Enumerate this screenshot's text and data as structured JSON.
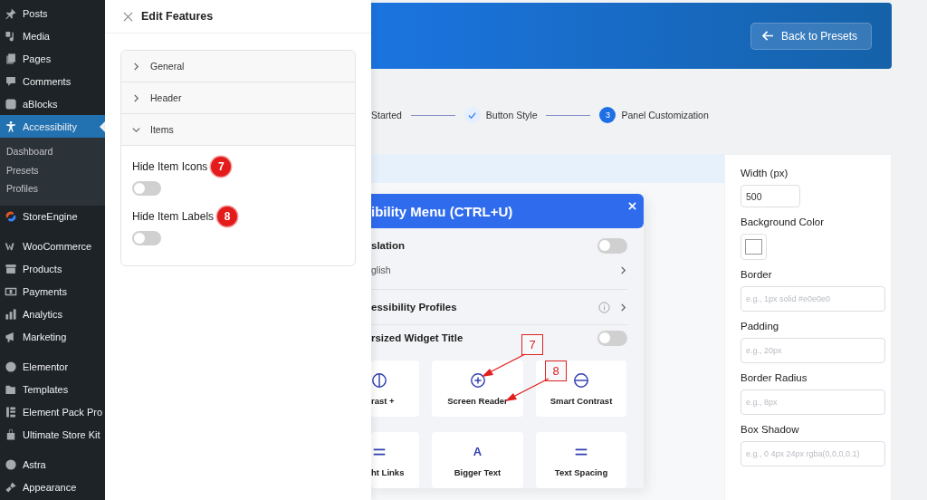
{
  "sidebar": {
    "groups": [
      {
        "items": [
          {
            "label": "Posts",
            "selected": false
          },
          {
            "label": "Media",
            "selected": false
          },
          {
            "label": "Pages",
            "selected": false
          },
          {
            "label": "Comments",
            "selected": false
          },
          {
            "label": "aBlocks",
            "selected": false
          },
          {
            "label": "Accessibility",
            "selected": true,
            "children": [
              {
                "label": "Dashboard",
                "selected": false
              },
              {
                "label": "Presets",
                "selected": false
              },
              {
                "label": "Profiles",
                "selected": false
              }
            ]
          },
          {
            "label": "StoreEngine",
            "selected": false
          }
        ]
      },
      {
        "items": [
          {
            "label": "WooCommerce",
            "selected": false
          },
          {
            "label": "Products",
            "selected": false
          },
          {
            "label": "Payments",
            "selected": false
          },
          {
            "label": "Analytics",
            "selected": false
          },
          {
            "label": "Marketing",
            "selected": false
          }
        ]
      },
      {
        "items": [
          {
            "label": "Elementor",
            "selected": false
          },
          {
            "label": "Templates",
            "selected": false
          },
          {
            "label": "Element Pack Pro",
            "selected": false
          },
          {
            "label": "Ultimate Store Kit",
            "selected": false
          }
        ]
      },
      {
        "items": [
          {
            "label": "Astra",
            "selected": false
          },
          {
            "label": "Appearance",
            "selected": false
          }
        ]
      }
    ]
  },
  "drawer": {
    "title": "Edit Features",
    "sections": [
      {
        "label": "General",
        "expanded": false
      },
      {
        "label": "Header",
        "expanded": false
      },
      {
        "label": "Items",
        "expanded": true,
        "settings": [
          {
            "label": "Hide Item Icons",
            "badge": "7",
            "on": false
          },
          {
            "label": "Hide Item Labels",
            "badge": "8",
            "on": false
          }
        ]
      }
    ]
  },
  "banner": {
    "button": "Back to Presets"
  },
  "steps": [
    {
      "label": "Started"
    },
    {
      "label": "Button Style",
      "completed": true
    },
    {
      "label": "Panel Customization",
      "completed": false,
      "number": "3"
    }
  ],
  "preview": {
    "title": "ibility Menu (CTRL+U)",
    "rows": [
      {
        "kind": "toggle",
        "label": "slation",
        "on": false
      },
      {
        "kind": "select",
        "label": "glish"
      },
      {
        "kind": "link",
        "label": "essibility Profiles"
      },
      {
        "kind": "toggle",
        "label": "rsized Widget Title",
        "on": false
      }
    ],
    "tiles": [
      {
        "label": "rast +",
        "kind": "contrast"
      },
      {
        "label": "Screen Reader",
        "kind": "plus"
      },
      {
        "label": "Smart Contrast",
        "kind": "minus"
      },
      {
        "label": "ht Links",
        "kind": "equals"
      },
      {
        "label": "Bigger Text",
        "kind": "letter",
        "glyph": "A"
      },
      {
        "label": "Text Spacing",
        "kind": "equals"
      }
    ],
    "annotations": [
      "7",
      "8"
    ]
  },
  "settings": [
    {
      "label": "Width (px)",
      "kind": "input",
      "value": "500"
    },
    {
      "label": "Background Color",
      "kind": "color"
    },
    {
      "label": "Border",
      "kind": "input",
      "placeholder": "e.g., 1px solid #e0e0e0"
    },
    {
      "label": "Padding",
      "kind": "input",
      "placeholder": "e.g., 20px"
    },
    {
      "label": "Border Radius",
      "kind": "input",
      "placeholder": "e.g., 8px"
    },
    {
      "label": "Box Shadow",
      "kind": "input",
      "placeholder": "e.g., 0 4px 24px rgba(0,0,0,0.1)"
    }
  ]
}
